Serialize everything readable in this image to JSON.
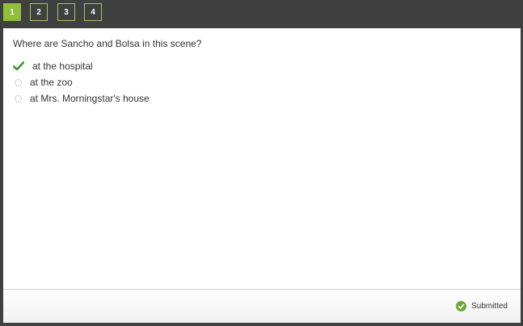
{
  "nav": {
    "questions": [
      "1",
      "2",
      "3",
      "4"
    ],
    "active_index": 0
  },
  "question": {
    "text": "Where are Sancho and Bolsa in this scene?",
    "options": [
      {
        "label": "at the hospital",
        "selected": true,
        "correct": true
      },
      {
        "label": "at the zoo",
        "selected": false
      },
      {
        "label": "at Mrs. Morningstar's house",
        "selected": false
      }
    ]
  },
  "footer": {
    "status": "Submitted"
  },
  "colors": {
    "topbar": "#404040",
    "accent_green": "#8fbf3c",
    "check_green": "#3b9a2f"
  },
  "icons": {
    "option_selected": "check-icon",
    "status": "check-circle-icon"
  }
}
